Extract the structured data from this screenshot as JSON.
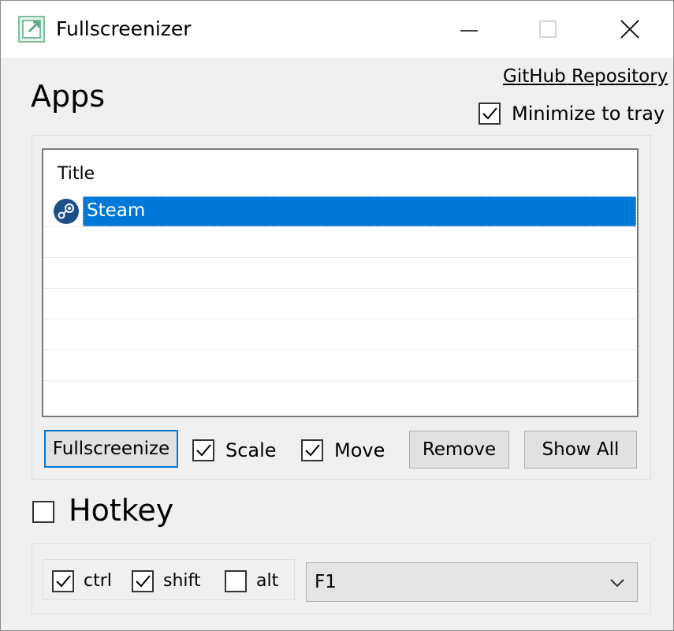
{
  "window": {
    "title": "Fullscreenizer",
    "icon": "app-window-icon"
  },
  "header": {
    "github_link": "GitHub Repository",
    "apps_heading": "Apps",
    "minimize_to_tray": {
      "label": "Minimize to tray",
      "checked": true
    }
  },
  "apps_list": {
    "columns": [
      "Title"
    ],
    "rows": [
      {
        "title": "Steam",
        "icon": "steam-icon",
        "selected": true
      }
    ]
  },
  "actions": {
    "fullscreenize_label": "Fullscreenize",
    "scale": {
      "label": "Scale",
      "checked": true
    },
    "move": {
      "label": "Move",
      "checked": true
    },
    "remove_label": "Remove",
    "show_all_label": "Show All"
  },
  "hotkey": {
    "label": "Hotkey",
    "enabled": false,
    "ctrl": {
      "label": "ctrl",
      "checked": true
    },
    "shift": {
      "label": "shift",
      "checked": true
    },
    "alt": {
      "label": "alt",
      "checked": false
    },
    "key": "F1"
  },
  "colors": {
    "selection": "#0078d7",
    "titlebar": "#ffffff",
    "window_bg": "#f0f0f0"
  }
}
